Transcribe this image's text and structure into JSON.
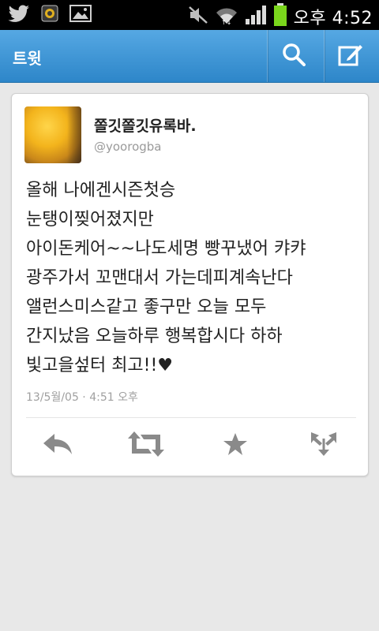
{
  "status_bar": {
    "time": "오후 4:52",
    "icons": [
      "twitter-icon",
      "app-icon",
      "image-icon",
      "mute-icon",
      "wifi-icon",
      "signal-icon",
      "battery-icon"
    ]
  },
  "action_bar": {
    "title": "트윗",
    "icons": [
      "search-icon",
      "compose-icon"
    ]
  },
  "tweet": {
    "author_name": "쫄깃쫄깃유록바.",
    "handle": "@yoorogba",
    "lines": [
      "올해 나에겐시즌첫승",
      "눈탱이찢어졌지만",
      "아이돈케어~~나도세명 빵꾸냈어 캬캬",
      "광주가서 꼬맨대서 가는데피계속난다",
      "앨런스미스같고 좋구만 오늘 모두",
      "간지났음 오늘하루 행복합시다 하하",
      "빛고을섶터 최고!!♥"
    ],
    "timestamp": "13/5월/05 · 4:51 오후"
  },
  "tweet_actions": [
    "reply-icon",
    "retweet-icon",
    "favorite-icon",
    "share-icon"
  ],
  "colors": {
    "action_bar_top": "#56a8e3",
    "action_bar_bottom": "#2d86c9",
    "background": "#e8e8e8",
    "battery": "#7ad61c"
  }
}
